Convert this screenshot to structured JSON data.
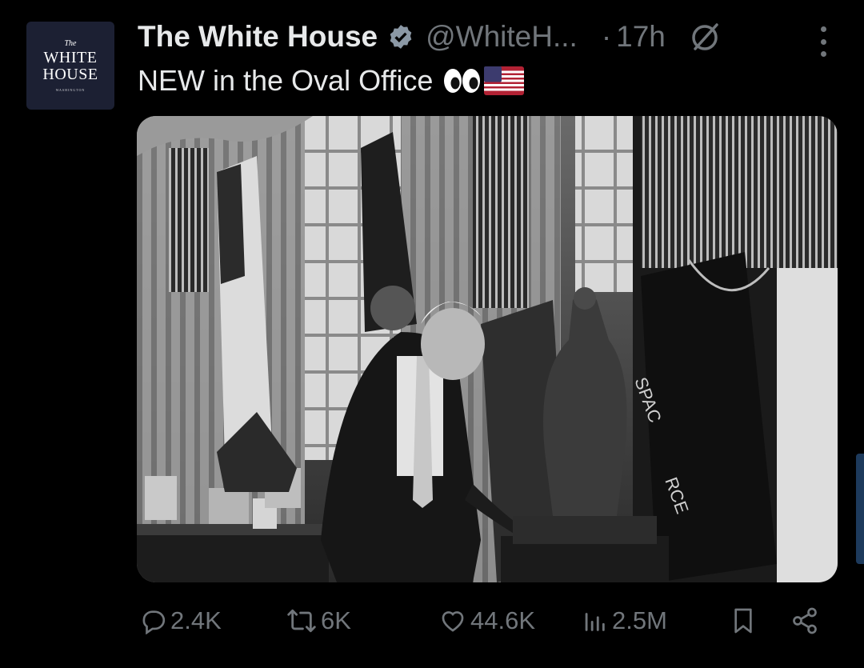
{
  "account": {
    "avatar_lines": [
      "The",
      "WHITE",
      "HOUSE",
      "WASHINGTON"
    ],
    "name": "The White House",
    "handle": "@WhiteH...",
    "separator": "·",
    "time": "17h",
    "verified_icon": "verified-badge-icon",
    "grok_icon": "grok-icon",
    "more_icon": "more-vertical-icon"
  },
  "post": {
    "text": "NEW in the Oval Office",
    "emoji": [
      "eyes-emoji",
      "us-flag-emoji"
    ],
    "photo_labels": [
      "SPAC",
      "RCE"
    ]
  },
  "actions": {
    "replies": "2.4K",
    "reposts": "6K",
    "likes": "44.6K",
    "views": "2.5M",
    "icons": [
      "reply-icon",
      "repost-icon",
      "like-icon",
      "views-icon",
      "bookmark-icon",
      "share-icon"
    ]
  },
  "colors": {
    "background": "#000000",
    "text": "#e7e9ea",
    "muted": "#71767b",
    "verified": "#8b98a5"
  }
}
